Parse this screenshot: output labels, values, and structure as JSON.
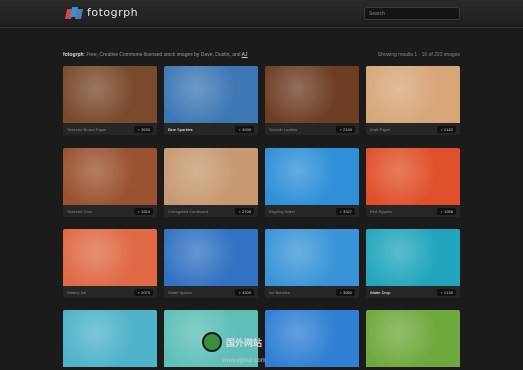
{
  "app": {
    "name": "fotogrph"
  },
  "search": {
    "placeholder": "Search"
  },
  "intro": {
    "brand": "fotogrph",
    "text": ": Free, Creative Commons-licensed stock images by Dave, Dustin, and ",
    "link": "AJ"
  },
  "results": {
    "text": "Showing results 1 - 16 of 223 images"
  },
  "cards": [
    {
      "title": "Textured Brown Paper",
      "count": "3530",
      "bg": "#7a4a2c",
      "highlight": false
    },
    {
      "title": "Blue Sparkles",
      "count": "3939",
      "bg": "#3e78b4",
      "highlight": true
    },
    {
      "title": "Smooth Leather",
      "count": "2149",
      "bg": "#6e3e24",
      "highlight": false
    },
    {
      "title": "Kraft Paper",
      "count": "2182",
      "bg": "#d7a77a",
      "highlight": false
    },
    {
      "title": "Textured Cork",
      "count": "3324",
      "bg": "#9a5230",
      "highlight": false
    },
    {
      "title": "Corrugated Cardboard",
      "count": "2708",
      "bg": "#c79a72",
      "highlight": false
    },
    {
      "title": "Rippling Water",
      "count": "3327",
      "bg": "#2f8fd8",
      "highlight": false
    },
    {
      "title": "Red Ripples",
      "count": "1958",
      "bg": "#e0502a",
      "highlight": false
    },
    {
      "title": "Watery Ink",
      "count": "2070",
      "bg": "#e06a45",
      "highlight": false
    },
    {
      "title": "Water Splash",
      "count": "4200",
      "bg": "#3172c2",
      "highlight": false
    },
    {
      "title": "Ice Bubbles",
      "count": "3950",
      "bg": "#3a95d8",
      "highlight": false
    },
    {
      "title": "Water Drop",
      "count": "2130",
      "bg": "#23a6bd",
      "highlight": true
    },
    {
      "title": "",
      "count": "",
      "bg": "#4fb3c9",
      "highlight": false
    },
    {
      "title": "",
      "count": "",
      "bg": "#5ebfb8",
      "highlight": false
    },
    {
      "title": "",
      "count": "",
      "bg": "#2f7fd4",
      "highlight": false
    },
    {
      "title": "",
      "count": "",
      "bg": "#6fa83c",
      "highlight": false
    }
  ],
  "watermark": {
    "text": "国外网站",
    "url": "www.egouz.com"
  }
}
